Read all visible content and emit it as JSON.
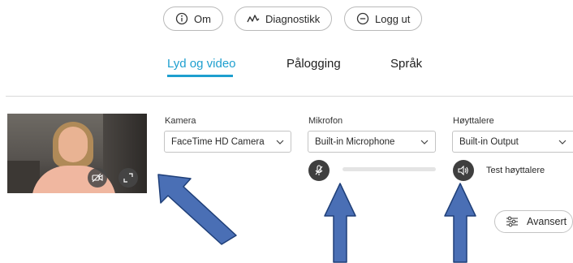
{
  "header_buttons": {
    "about": "Om",
    "diagnostics": "Diagnostikk",
    "logout": "Logg ut"
  },
  "tabs": [
    {
      "label": "Lyd og video",
      "active": true
    },
    {
      "label": "Pålogging",
      "active": false
    },
    {
      "label": "Språk",
      "active": false
    }
  ],
  "camera": {
    "label": "Kamera",
    "selected": "FaceTime HD Camera"
  },
  "microphone": {
    "label": "Mikrofon",
    "selected": "Built-in Microphone",
    "level_percent": 0
  },
  "speakers": {
    "label": "Høyttalere",
    "selected": "Built-in Output",
    "test_label": "Test høyttalere"
  },
  "advanced_button": "Avansert",
  "colors": {
    "accent": "#1e9fcf",
    "annotation_arrow_fill": "#4a6fb5",
    "annotation_arrow_stroke": "#1f3f78"
  },
  "icons": [
    "info-icon",
    "diagnostics-icon",
    "logout-icon",
    "camera-off-icon",
    "expand-icon",
    "mic-muted-icon",
    "speaker-icon",
    "sliders-icon",
    "chevron-down-icon"
  ]
}
